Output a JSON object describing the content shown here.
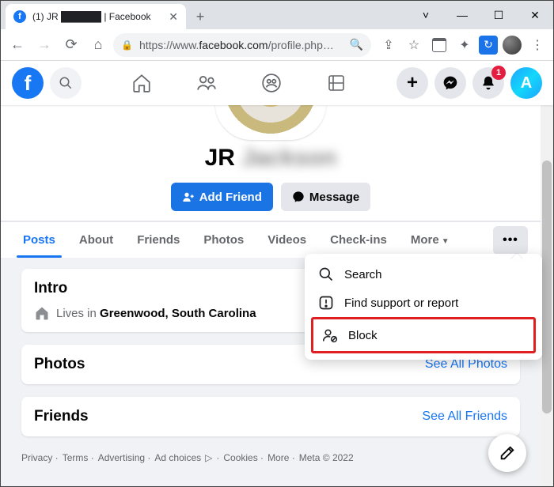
{
  "browser": {
    "tab_title": "(1) JR ██████ | Facebook",
    "url_prefix": "https://www.",
    "url_domain": "facebook.com",
    "url_path": "/profile.php…"
  },
  "fb": {
    "notification_count": "1"
  },
  "profile": {
    "name_first": "JR",
    "name_rest": "Jackson",
    "add_friend": "Add Friend",
    "message": "Message"
  },
  "tabs": {
    "posts": "Posts",
    "about": "About",
    "friends": "Friends",
    "photos": "Photos",
    "videos": "Videos",
    "checkins": "Check-ins",
    "more": "More"
  },
  "intro": {
    "heading": "Intro",
    "prefix": "Lives in ",
    "place": "Greenwood, South Carolina"
  },
  "photos": {
    "heading": "Photos",
    "link": "See All Photos"
  },
  "friends": {
    "heading": "Friends",
    "link": "See All Friends"
  },
  "menu": {
    "search": "Search",
    "report": "Find support or report",
    "block": "Block"
  },
  "footer": {
    "privacy": "Privacy",
    "terms": "Terms",
    "advertising": "Advertising",
    "adchoices": "Ad choices",
    "cookies": "Cookies",
    "more": "More",
    "meta": "Meta © 2022"
  }
}
